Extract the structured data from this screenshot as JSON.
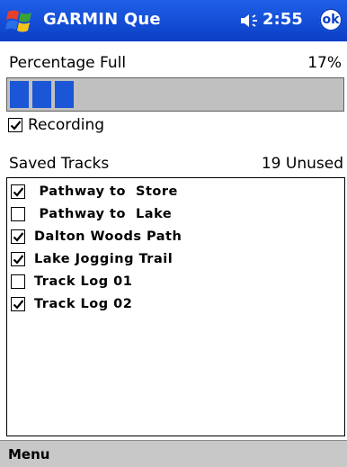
{
  "titlebar": {
    "app_title": "GARMIN Que",
    "time": "2:55",
    "ok_label": "ok",
    "volume_icon": "speaker-icon",
    "start_icon": "windows-flag-icon",
    "color": "#0b3fc6"
  },
  "status": {
    "percentage_label": "Percentage Full",
    "percentage_value": "17%",
    "progress_fraction": 0.17
  },
  "recording": {
    "label": "Recording",
    "checked": true
  },
  "saved_tracks": {
    "label": "Saved Tracks",
    "count": "19 Unused"
  },
  "tracks": [
    {
      "name": " Pathway to  Store",
      "checked": true
    },
    {
      "name": " Pathway to  Lake",
      "checked": false
    },
    {
      "name": "Dalton Woods Path",
      "checked": true
    },
    {
      "name": "Lake Jogging Trail",
      "checked": true
    },
    {
      "name": "Track Log 01",
      "checked": false
    },
    {
      "name": "Track Log 02",
      "checked": true
    }
  ],
  "menubar": {
    "menu_label": "Menu"
  }
}
